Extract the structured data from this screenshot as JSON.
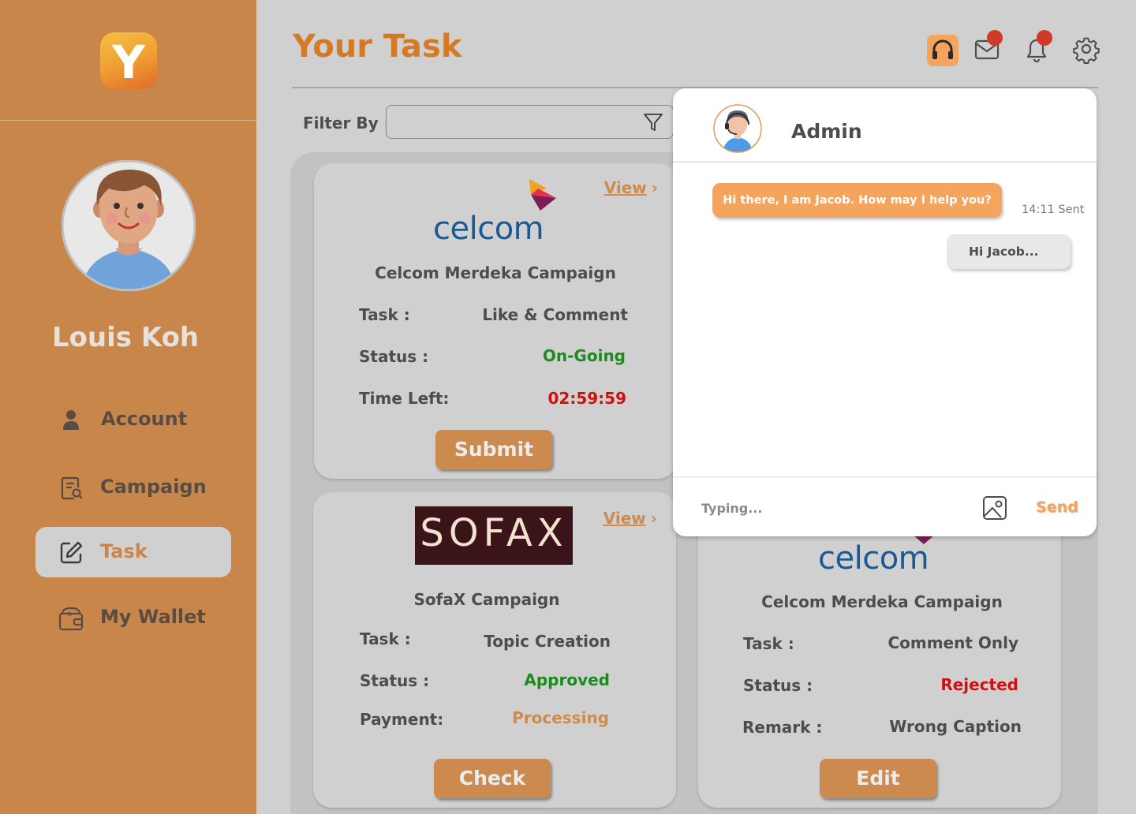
{
  "app": {
    "logo_letter": "Y"
  },
  "user": {
    "name": "Louis Koh"
  },
  "sidebar": {
    "items": [
      {
        "label": "Account",
        "icon": "user-icon"
      },
      {
        "label": "Campaign",
        "icon": "campaign-search-icon"
      },
      {
        "label": "Task",
        "icon": "edit-icon",
        "active": true
      },
      {
        "label": "My Wallet",
        "icon": "wallet-icon"
      }
    ]
  },
  "header": {
    "title": "Your Task",
    "icons": [
      "headset-icon",
      "mail-icon",
      "bell-icon",
      "gear-icon"
    ]
  },
  "filter": {
    "label": "Filter By :",
    "value": ""
  },
  "cards": [
    {
      "brand": "celcom",
      "view_label": "View",
      "campaign": "Celcom Merdeka Campaign",
      "rows": [
        {
          "label": "Task :",
          "value": "Like & Comment"
        },
        {
          "label": "Status :",
          "value": "On-Going"
        },
        {
          "label": "Time Left:",
          "value": "02:59:59"
        }
      ],
      "action": "Submit"
    },
    {
      "brand": "SOFAX",
      "view_label": "View",
      "campaign": "SofaX Campaign",
      "rows": [
        {
          "label": "Task :",
          "value": "Topic Creation"
        },
        {
          "label": "Status :",
          "value": "Approved"
        },
        {
          "label": "Payment:",
          "value": "Processing"
        }
      ],
      "action": "Check"
    },
    {
      "brand": "celcom",
      "campaign": "Celcom Merdeka Campaign",
      "rows": [
        {
          "label": "Task :",
          "value": "Comment Only"
        },
        {
          "label": "Status :",
          "value": "Rejected"
        },
        {
          "label": "Remark :",
          "value": "Wrong Caption"
        }
      ],
      "action": "Edit"
    }
  ],
  "chat": {
    "name": "Admin",
    "messages": [
      {
        "text": "Hi there, I am Jacob. How may I help you?",
        "meta": "14:11 Sent"
      },
      {
        "text": "Hi Jacob..."
      }
    ],
    "input_placeholder": "Typing...",
    "send_label": "Send"
  },
  "colors": {
    "sidebar": "#c9864a",
    "accent": "#d57a24",
    "status_ongoing": "#1e8a1e",
    "status_approved": "#1e8a1e",
    "status_rejected": "#d01010",
    "time_left": "#d01010",
    "payment_processing": "#cf8a4e"
  }
}
